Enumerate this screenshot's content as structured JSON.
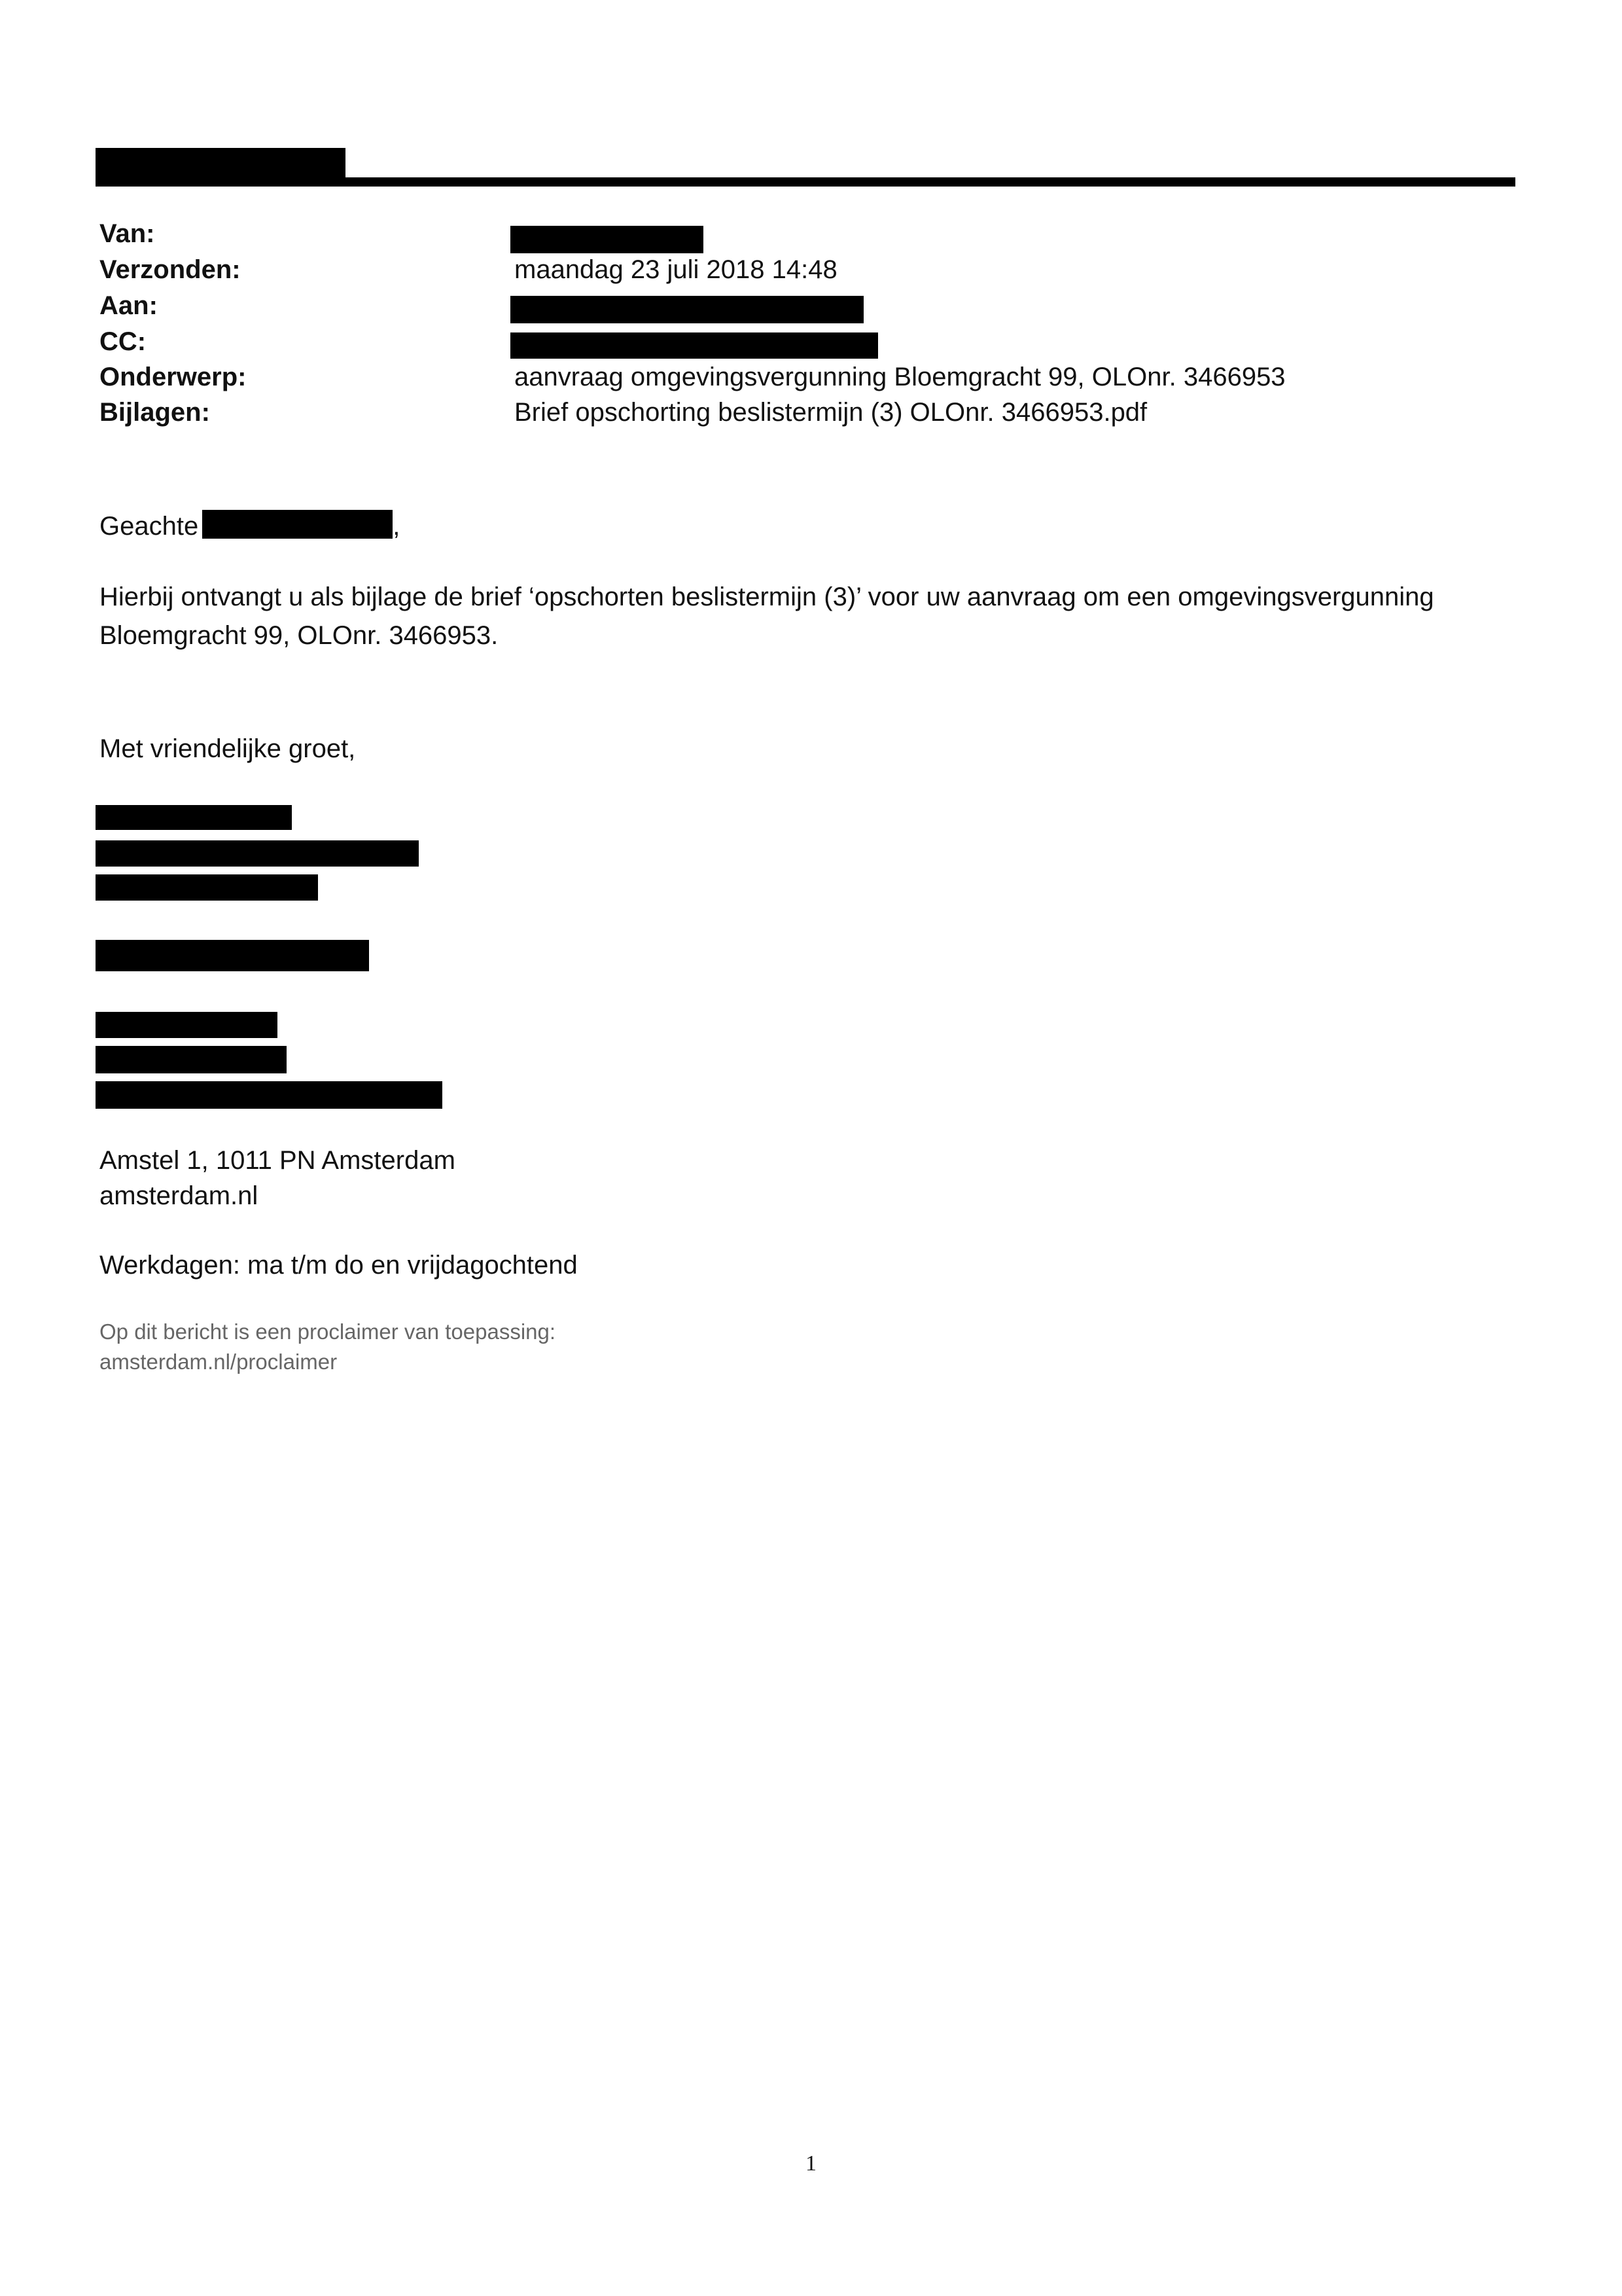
{
  "header": {
    "fields": [
      {
        "label": "Van:",
        "value": ""
      },
      {
        "label": "Verzonden:",
        "value": "maandag 23 juli 2018 14:48"
      },
      {
        "label": "Aan:",
        "value": ""
      },
      {
        "label": "CC:",
        "value": ""
      },
      {
        "label": "Onderwerp:",
        "value": "aanvraag omgevingsvergunning Bloemgracht 99, OLOnr. 3466953"
      },
      {
        "label": "Bijlagen:",
        "value": "Brief opschorting beslistermijn (3) OLOnr. 3466953.pdf"
      }
    ]
  },
  "body": {
    "salutation": "Geachte",
    "salutation_punct": ",",
    "paragraph_line1": "Hierbij ontvangt u als bijlage de brief ‘opschorten beslistermijn (3)’ voor uw aanvraag om een omgevingsvergunning",
    "paragraph_line2": "Bloemgracht 99, OLOnr. 3466953.",
    "closing": "Met vriendelijke groet,",
    "address_line1": "Amstel 1, 1011 PN Amsterdam",
    "address_line2": "amsterdam.nl",
    "workdays": "Werkdagen: ma t/m do en vrijdagochtend",
    "proclaimer_line1": "Op dit bericht is een proclaimer van toepassing:",
    "proclaimer_line2": "amsterdam.nl/proclaimer"
  },
  "footer": {
    "page_number": "1"
  }
}
